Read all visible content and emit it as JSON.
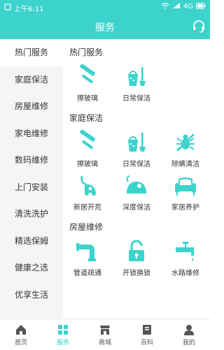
{
  "status_bar": {
    "time": "上午6:11",
    "battery_text": "4G"
  },
  "header": {
    "title": "服务",
    "headset_icon": "headset-icon"
  },
  "sidebar": {
    "items": [
      {
        "label": "热门服务",
        "active": true
      },
      {
        "label": "家庭保洁"
      },
      {
        "label": "房屋维修"
      },
      {
        "label": "家电维修"
      },
      {
        "label": "数码维修"
      },
      {
        "label": "上门安装"
      },
      {
        "label": "清洗洗护"
      },
      {
        "label": "精选保姆"
      },
      {
        "label": "健康之选"
      },
      {
        "label": "优享生活"
      },
      {
        "label": ""
      }
    ]
  },
  "sections": [
    {
      "title": "热门服务",
      "items": [
        {
          "label": "擦玻璃",
          "icon": "squeegee-icon"
        },
        {
          "label": "日常保洁",
          "icon": "cleaning-bucket-icon"
        }
      ]
    },
    {
      "title": "家庭保洁",
      "items": [
        {
          "label": "擦玻璃",
          "icon": "squeegee-icon"
        },
        {
          "label": "日常保洁",
          "icon": "cleaning-bucket-icon"
        },
        {
          "label": "除螨清洁",
          "icon": "bug-icon"
        },
        {
          "label": "新居开荒",
          "icon": "vacuum-cleaner-icon"
        },
        {
          "label": "深度保洁",
          "icon": "vacuum-icon"
        },
        {
          "label": "家居养护",
          "icon": "sofa-icon"
        }
      ]
    },
    {
      "title": "房屋维修",
      "items": [
        {
          "label": "管道疏通",
          "icon": "pipe-icon"
        },
        {
          "label": "开锁换锁",
          "icon": "padlock-icon"
        },
        {
          "label": "水路维修",
          "icon": "faucet-icon"
        }
      ]
    }
  ],
  "tabbar": {
    "items": [
      {
        "label": "首页",
        "icon": "home-icon"
      },
      {
        "label": "服务",
        "icon": "grid-icon",
        "active": true
      },
      {
        "label": "商城",
        "icon": "store-icon"
      },
      {
        "label": "百科",
        "icon": "book-icon"
      },
      {
        "label": "我的",
        "icon": "person-icon"
      }
    ]
  },
  "colors": {
    "accent": "#3cd3cc",
    "text": "#333333",
    "sidebar_bg": "#f5f5f5"
  }
}
